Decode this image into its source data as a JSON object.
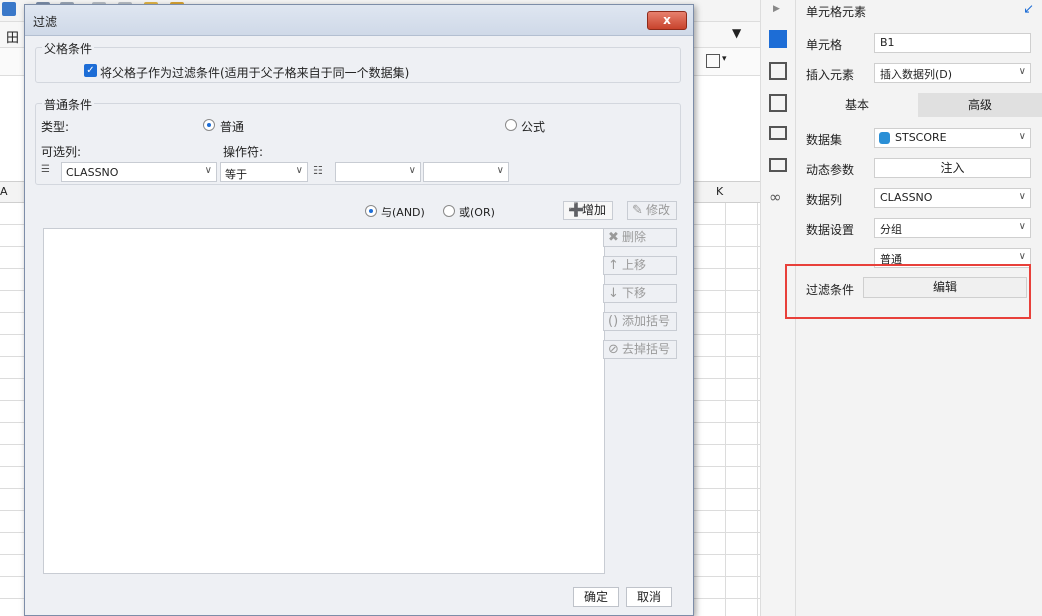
{
  "background": {
    "col_k_label": "K",
    "col_a_label": "A"
  },
  "right_panel": {
    "header_title": "单元格元素",
    "cell_label": "单元格",
    "cell_value": "B1",
    "insert_label": "插入元素",
    "insert_value": "插入数据列(D)",
    "tabs": [
      "基本",
      "高级"
    ],
    "dataset_label": "数据集",
    "dataset_value": "STSCORE",
    "dynamic_param_label": "动态参数",
    "inject_label": "注入",
    "datacol_label": "数据列",
    "datacol_value": "CLASSNO",
    "datasetting_label": "数据设置",
    "datasetting_value": "分组",
    "datasetting_sub_value": "普通",
    "filter_label": "过滤条件",
    "filter_button": "编辑",
    "highlight_color": "#e8403a"
  },
  "dialog": {
    "title": "过滤",
    "close_label": "x",
    "parent_group_title": "父格条件",
    "parent_checkbox_label": "将父格子作为过滤条件(适用于父子格来自于同一个数据集)",
    "parent_checked": true,
    "normal_group_title": "普通条件",
    "type_label": "类型:",
    "type_options": [
      "普通",
      "公式"
    ],
    "type_selected": "普通",
    "column_label": "可选列:",
    "column_value": "CLASSNO",
    "operator_label": "操作符:",
    "operator_value": "等于",
    "value_1": "",
    "value_2": "",
    "logic_options": [
      "与(AND)",
      "或(OR)"
    ],
    "logic_selected": "与(AND)",
    "add_label": "增加",
    "modify_label": "修改",
    "delete_label": "删除",
    "up_label": "上移",
    "down_label": "下移",
    "add_bracket_label": "添加括号",
    "remove_bracket_label": "去掉括号",
    "ok_label": "确定",
    "cancel_label": "取消"
  }
}
